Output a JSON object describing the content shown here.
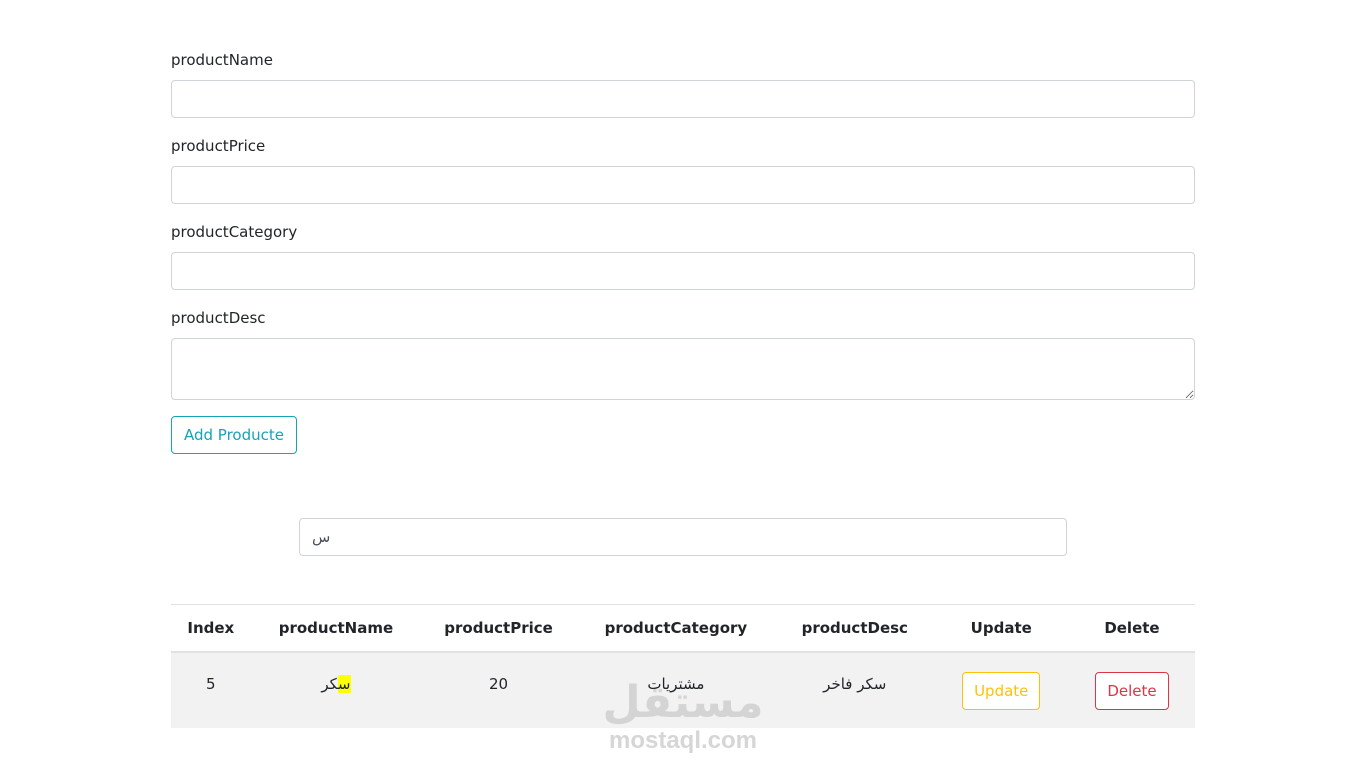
{
  "form": {
    "fields": [
      {
        "label": "productName",
        "value": ""
      },
      {
        "label": "productPrice",
        "value": ""
      },
      {
        "label": "productCategory",
        "value": ""
      },
      {
        "label": "productDesc",
        "value": ""
      }
    ],
    "add_button_label": "Add Producte"
  },
  "search": {
    "value": "س"
  },
  "table": {
    "headers": [
      "Index",
      "productName",
      "productPrice",
      "productCategory",
      "productDesc",
      "Update",
      "Delete"
    ],
    "rows": [
      {
        "index": "5",
        "name_highlight": "س",
        "name_rest": "كر",
        "price": "20",
        "category": "مشتريات",
        "desc": "سكر فاخر",
        "update_label": "Update",
        "delete_label": "Delete"
      }
    ]
  },
  "watermark": {
    "arabic": "مستقل",
    "latin": "mostaql.com"
  },
  "colors": {
    "info": "#17a2b8",
    "warning": "#ffc107",
    "danger": "#dc3545",
    "highlight": "#ffff00",
    "row_bg": "#f2f2f2"
  }
}
